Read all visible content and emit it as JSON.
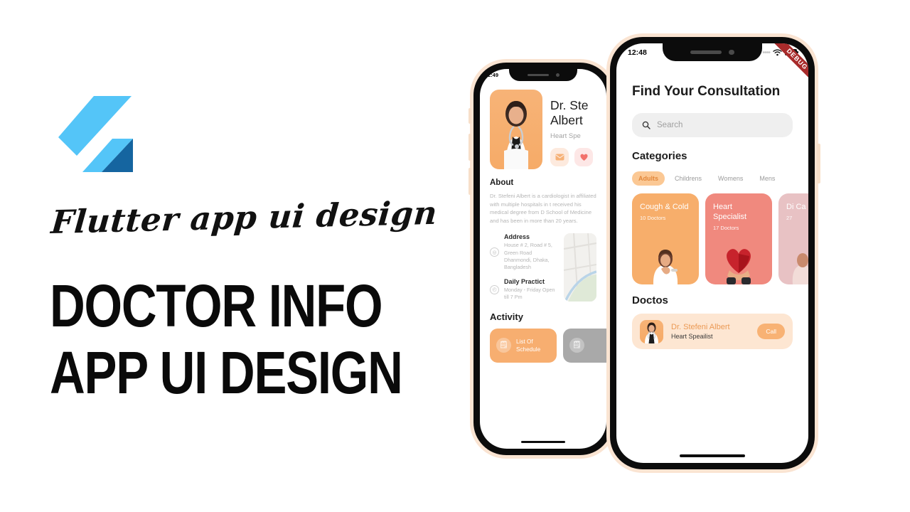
{
  "branding": {
    "logo_name": "flutter-logo",
    "script_text": "Flutter app ui design",
    "title_line1": "DOCTOR INFO",
    "title_line2": "APP UI DESIGN"
  },
  "back_phone": {
    "status": {
      "time": "2:49"
    },
    "doctor": {
      "name_line1": "Dr. Ste",
      "name_line2": "Albert",
      "specialty": "Heart Spe"
    },
    "about": {
      "heading": "About",
      "text": "Dr. Stefeni Albert is a cardiologist in affiliated with multiple hospitals in t received his medical degree from D School of Medicine and has been in more than 20 years."
    },
    "address": {
      "title": "Address",
      "lines": "House # 2, Road # 5, Green Road Dhanmondi, Dhaka, Bangladesh"
    },
    "practice": {
      "title": "Daily Practict",
      "lines": "Monday - Friday Open till 7 Pm"
    },
    "activity": {
      "heading": "Activity",
      "card1_label": "List Of Schedule",
      "card2_label": ""
    }
  },
  "front_phone": {
    "status": {
      "time": "12:48",
      "debug_badge": "DEBUG"
    },
    "title": "Find Your Consultation",
    "search": {
      "placeholder": "Search"
    },
    "categories": {
      "heading": "Categories",
      "tabs": [
        {
          "label": "Adults",
          "active": true
        },
        {
          "label": "Childrens",
          "active": false
        },
        {
          "label": "Womens",
          "active": false
        },
        {
          "label": "Mens",
          "active": false
        }
      ],
      "cards": [
        {
          "title": "Cough & Cold",
          "doctors": "10 Doctors",
          "color": "#f7ae6b"
        },
        {
          "title": "Heart Specialist",
          "doctors": "17 Doctors",
          "color": "#f0897e"
        },
        {
          "title": "Di Ca",
          "doctors": "27",
          "color": "#e8c2c4"
        }
      ]
    },
    "doctors": {
      "heading": "Doctos",
      "list": [
        {
          "name": "Dr. Stefeni Albert",
          "specialty": "Heart Speailist",
          "action": "Call"
        }
      ]
    }
  },
  "colors": {
    "accent_orange": "#f7ae6b",
    "accent_salmon": "#f0897e",
    "accent_pink": "#e8c2c4",
    "card_bg": "#fde6d2",
    "flutter_light": "#54c5f8",
    "flutter_dark": "#1565a0",
    "debug_red": "#a82b2b"
  }
}
